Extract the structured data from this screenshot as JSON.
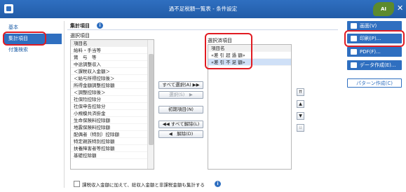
{
  "window": {
    "title": "過不足税額一覧表 - 条件設定",
    "logo_text": "AI",
    "close": "✕"
  },
  "sidebar": {
    "items": [
      {
        "label": "基本"
      },
      {
        "label": "集計項目"
      },
      {
        "label": "付箋検索"
      }
    ]
  },
  "main": {
    "section_title": "集計項目",
    "info_icon_glyph": "i",
    "available": {
      "label": "選択項目",
      "header": "項目名",
      "rows": [
        "給料・手当等",
        "賞　与　等",
        "中途調整収入",
        "＜課税収入金額＞",
        "＜給与所得控除後＞",
        "所得金額調整控除額",
        "＜調整控除後＞",
        "社保险控除分",
        "社保申告控除分",
        "小規模共済掛金",
        "生命保険料控除額",
        "地震保険料控除額",
        "配偶者（特別）控除額",
        "特定親族特別控除額",
        "扶養障害者等控除額",
        "基礎控除額"
      ]
    },
    "selected": {
      "label": "選択済項目",
      "header": "項目名",
      "rows": [
        "«差 引 超 過 額»",
        "«差 引 不 足 額»"
      ]
    },
    "buttons": {
      "select_all": "すべて選択(A) ▶▶",
      "select": "選択(S)　▶",
      "initial": "初期項目(N)",
      "deselect_all": "◀◀ すべて解除(L)",
      "deselect": "◀　解除(D)"
    },
    "order_buttons": [
      "⇈",
      "▲",
      "▼",
      "⇊"
    ],
    "footer_text": "課税収入金額に加えて、総収入金額と非課税金額も集計する"
  },
  "actions": {
    "screen": "画面(V)",
    "print": "印刷(P)...",
    "pdf": "PDF(F)...",
    "data": "データ作成(E)...",
    "pattern": "パターン作成(C)"
  }
}
